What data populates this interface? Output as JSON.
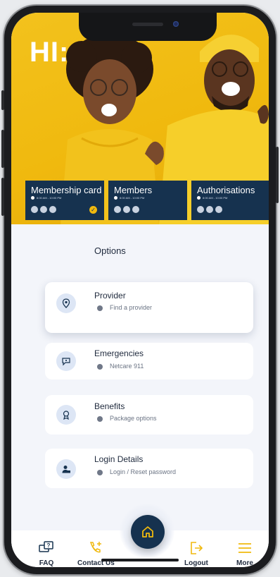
{
  "greeting": "HI:",
  "cards": [
    {
      "title": "Membership card",
      "sub": "8:00 AM - 10:00 PM",
      "checked": true
    },
    {
      "title": "Members",
      "sub": "8:00 AM - 10:00 PM",
      "checked": false
    },
    {
      "title": "Authorisations",
      "sub": "8:00 AM - 10:00 PM",
      "checked": false
    }
  ],
  "options": {
    "label": "Options",
    "items": [
      {
        "title": "Provider",
        "subtitle": "Find a provider",
        "icon": "location-pin-icon"
      },
      {
        "title": "Emergencies",
        "subtitle": "Netcare 911",
        "icon": "emergency-chat-icon"
      },
      {
        "title": "Benefits",
        "subtitle": "Package options",
        "icon": "award-badge-icon"
      },
      {
        "title": "Login Details",
        "subtitle": "Login / Reset password",
        "icon": "user-lock-icon"
      }
    ]
  },
  "nav": {
    "faq": "FAQ",
    "contact": "Contact Us",
    "logout": "Logout",
    "more": "More"
  },
  "colors": {
    "accent": "#f0b90e",
    "navy": "#16324f",
    "background": "#f3f5fa"
  }
}
